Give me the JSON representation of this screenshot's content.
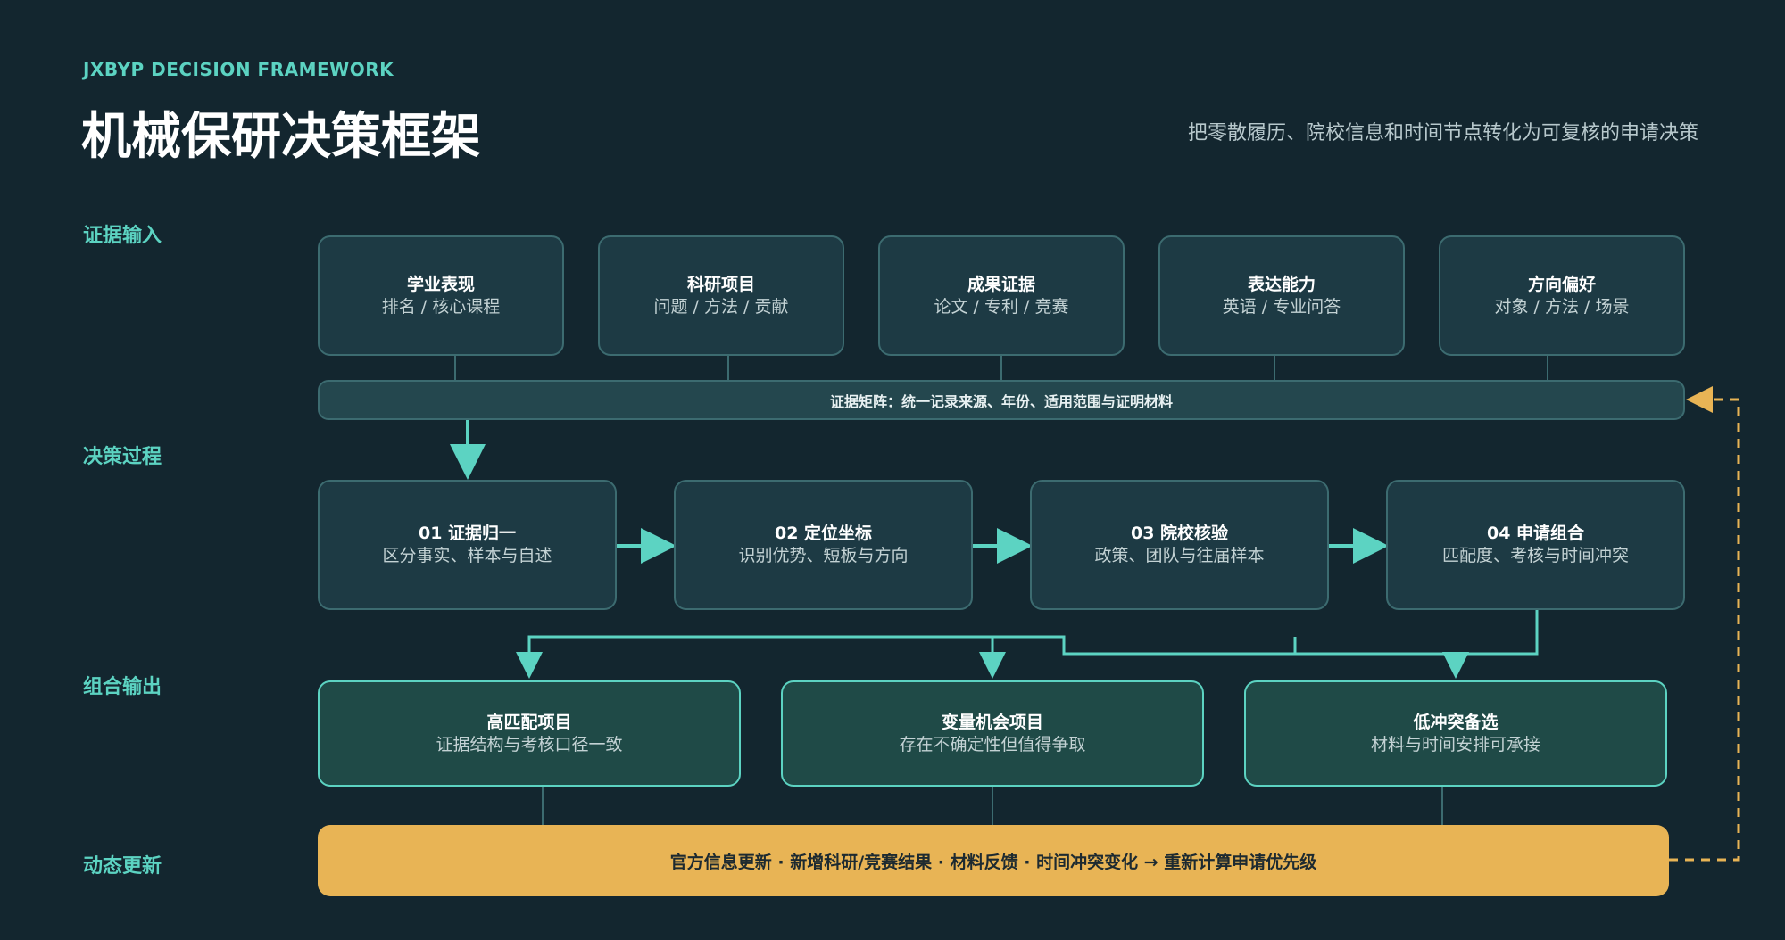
{
  "header": {
    "eyebrow": "JXBYP DECISION FRAMEWORK",
    "title": "机械保研决策框架",
    "subtitle": "把零散履历、院校信息和时间节点转化为可复核的申请决策"
  },
  "sections": {
    "input": "证据输入",
    "process": "决策过程",
    "output": "组合输出",
    "update": "动态更新"
  },
  "inputs": [
    {
      "title": "学业表现",
      "sub": "排名 / 核心课程"
    },
    {
      "title": "科研项目",
      "sub": "问题 / 方法 / 贡献"
    },
    {
      "title": "成果证据",
      "sub": "论文 / 专利 / 竞赛"
    },
    {
      "title": "表达能力",
      "sub": "英语 / 专业问答"
    },
    {
      "title": "方向偏好",
      "sub": "对象 / 方法 / 场景"
    }
  ],
  "matrix": "证据矩阵：统一记录来源、年份、适用范围与证明材料",
  "steps": [
    {
      "title": "01 证据归一",
      "sub": "区分事实、样本与自述"
    },
    {
      "title": "02 定位坐标",
      "sub": "识别优势、短板与方向"
    },
    {
      "title": "03 院校核验",
      "sub": "政策、团队与往届样本"
    },
    {
      "title": "04 申请组合",
      "sub": "匹配度、考核与时间冲突"
    }
  ],
  "outputs": [
    {
      "title": "高匹配项目",
      "sub": "证据结构与考核口径一致"
    },
    {
      "title": "变量机会项目",
      "sub": "存在不确定性但值得争取"
    },
    {
      "title": "低冲突备选",
      "sub": "材料与时间安排可承接"
    }
  ],
  "update_bar": "官方信息更新 · 新增科研/竞赛结果 · 材料反馈 · 时间冲突变化 → 重新计算申请优先级",
  "colors": {
    "background": "#13262f",
    "accent": "#5cd3c2",
    "update": "#e8b455",
    "box": "#1d3a44",
    "output_box": "#1f4a47"
  }
}
